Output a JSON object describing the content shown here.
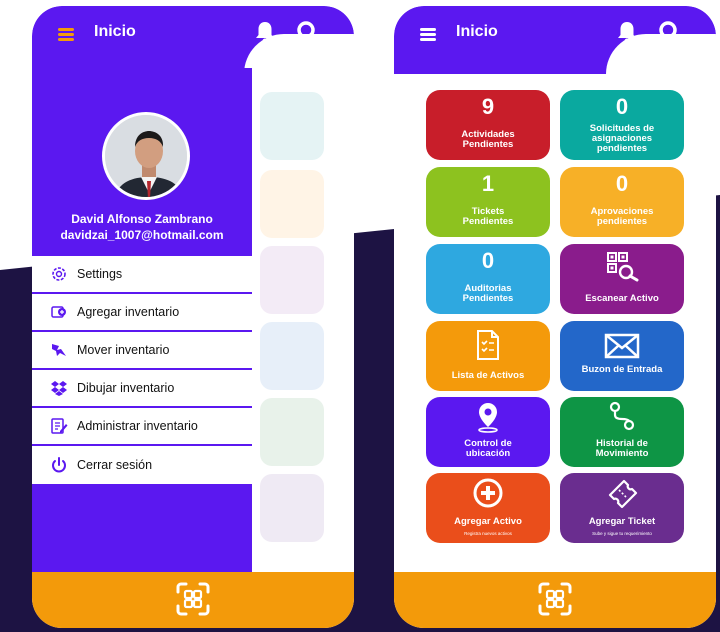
{
  "header": {
    "title": "Inicio"
  },
  "user": {
    "name": "David Alfonso Zambrano",
    "email": "davidzai_1007@hotmail.com"
  },
  "menu": [
    {
      "label": "Settings",
      "icon": "gear-icon"
    },
    {
      "label": "Agregar inventario",
      "icon": "add-box-icon"
    },
    {
      "label": "Mover inventario",
      "icon": "move-icon"
    },
    {
      "label": "Dibujar inventario",
      "icon": "dropbox-icon"
    },
    {
      "label": "Administrar inventario",
      "icon": "edit-doc-icon"
    },
    {
      "label": "Cerrar sesión",
      "icon": "power-icon"
    }
  ],
  "tiles": [
    {
      "number": "9",
      "label1": "Actividades",
      "label2": "Pendientes",
      "color": "#c81e2a"
    },
    {
      "number": "0",
      "label1": "Solicitudes de",
      "label2": "asignaciones",
      "label3": "pendientes",
      "color": "#0aa99f"
    },
    {
      "number": "1",
      "label1": "Tickets",
      "label2": "Pendientes",
      "color": "#8dc21f"
    },
    {
      "number": "0",
      "label1": "Aprovaciones",
      "label2": "pendientes",
      "color": "#f7b027"
    },
    {
      "number": "0",
      "label1": "Auditorias",
      "label2": "Pendientes",
      "color": "#2ea8e0"
    },
    {
      "label1": "Escanear Activo",
      "icon": "qr-search-icon",
      "color": "#8a1c8c"
    },
    {
      "label1": "Lista de Activos",
      "icon": "checklist-icon",
      "color": "#f49a0b"
    },
    {
      "label1": "Buzon de Entrada",
      "icon": "mail-icon",
      "color": "#2367c9"
    },
    {
      "label1": "Control de",
      "label2": "ubicación",
      "icon": "location-pin-icon",
      "color": "#5b18f0"
    },
    {
      "label1": "Historial de",
      "label2": "Movimiento",
      "icon": "route-icon",
      "color": "#0e9545"
    },
    {
      "label1": "Agregar Activo",
      "sublabel": "Registra nuevos activos",
      "icon": "plus-circle-icon",
      "color": "#ea4e1b"
    },
    {
      "label1": "Agregar Ticket",
      "sublabel": "Sube y sigue tu requerimiento",
      "icon": "ticket-icon",
      "color": "#6a2d8f"
    }
  ],
  "colors": {
    "primary": "#5b18f0",
    "accent": "#f39a0a",
    "background": "#1d1343"
  }
}
